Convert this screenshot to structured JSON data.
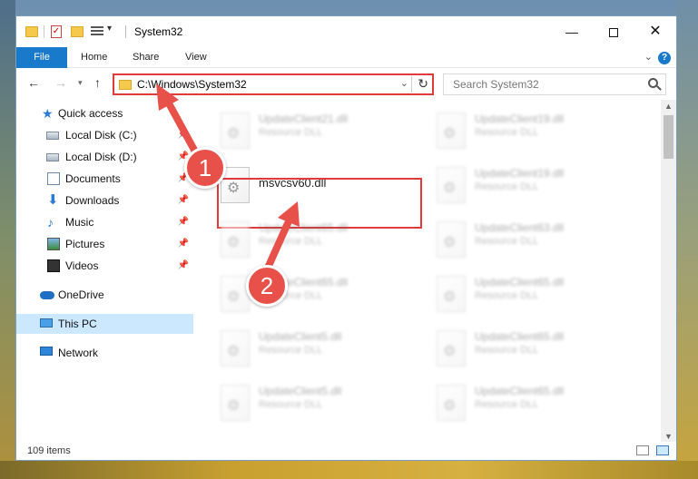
{
  "window": {
    "title": "System32",
    "controls": {
      "minimize": "—",
      "maximize": "",
      "close": "✕"
    }
  },
  "ribbon": {
    "tabs": [
      "File",
      "Home",
      "Share",
      "View"
    ],
    "help": "?"
  },
  "navigation": {
    "address": "C:\\Windows\\System32",
    "search_placeholder": "Search System32"
  },
  "sidebar": {
    "items": [
      {
        "label": "Quick access",
        "icon": "star-icon"
      },
      {
        "label": "Local Disk (C:)",
        "icon": "drive-icon",
        "pinned": true
      },
      {
        "label": "Local Disk (D:)",
        "icon": "drive-icon",
        "pinned": true
      },
      {
        "label": "Documents",
        "icon": "documents-icon",
        "pinned": true
      },
      {
        "label": "Downloads",
        "icon": "download-icon",
        "pinned": true
      },
      {
        "label": "Music",
        "icon": "music-icon",
        "pinned": true
      },
      {
        "label": "Pictures",
        "icon": "pictures-icon",
        "pinned": true
      },
      {
        "label": "Videos",
        "icon": "videos-icon",
        "pinned": true
      },
      {
        "label": "OneDrive",
        "icon": "onedrive-icon"
      },
      {
        "label": "This PC",
        "icon": "pc-icon",
        "selected": true
      },
      {
        "label": "Network",
        "icon": "network-icon"
      }
    ]
  },
  "files": {
    "highlighted": {
      "name": "msvcsv60.dll"
    },
    "blurred": [
      {
        "name": "UpdateClient21.dll",
        "desc": "Resource DLL"
      },
      {
        "name": "UpdateClient19.dll",
        "desc": "Resource DLL"
      },
      {
        "name": "UpdateClient19.dll",
        "desc": "Resource DLL"
      },
      {
        "name": "UpdateClient65.dll",
        "desc": "Resource DLL"
      },
      {
        "name": "UpdateClient63.dll",
        "desc": "Resource DLL"
      },
      {
        "name": "UpdateClient65.dll",
        "desc": "Resource DLL"
      },
      {
        "name": "UpdateClient65.dll",
        "desc": "Resource DLL"
      },
      {
        "name": "UpdateClient5.dll",
        "desc": "Resource DLL"
      },
      {
        "name": "UpdateClient65.dll",
        "desc": "Resource DLL"
      },
      {
        "name": "UpdateClient5.dll",
        "desc": "Resource DLL"
      },
      {
        "name": "UpdateClient65.dll",
        "desc": "Resource DLL"
      }
    ]
  },
  "status": {
    "count": "109 items"
  },
  "callouts": [
    "1",
    "2"
  ],
  "colors": {
    "accent": "#1979ca",
    "highlight": "#e03a3a",
    "callout": "#e8504a"
  }
}
